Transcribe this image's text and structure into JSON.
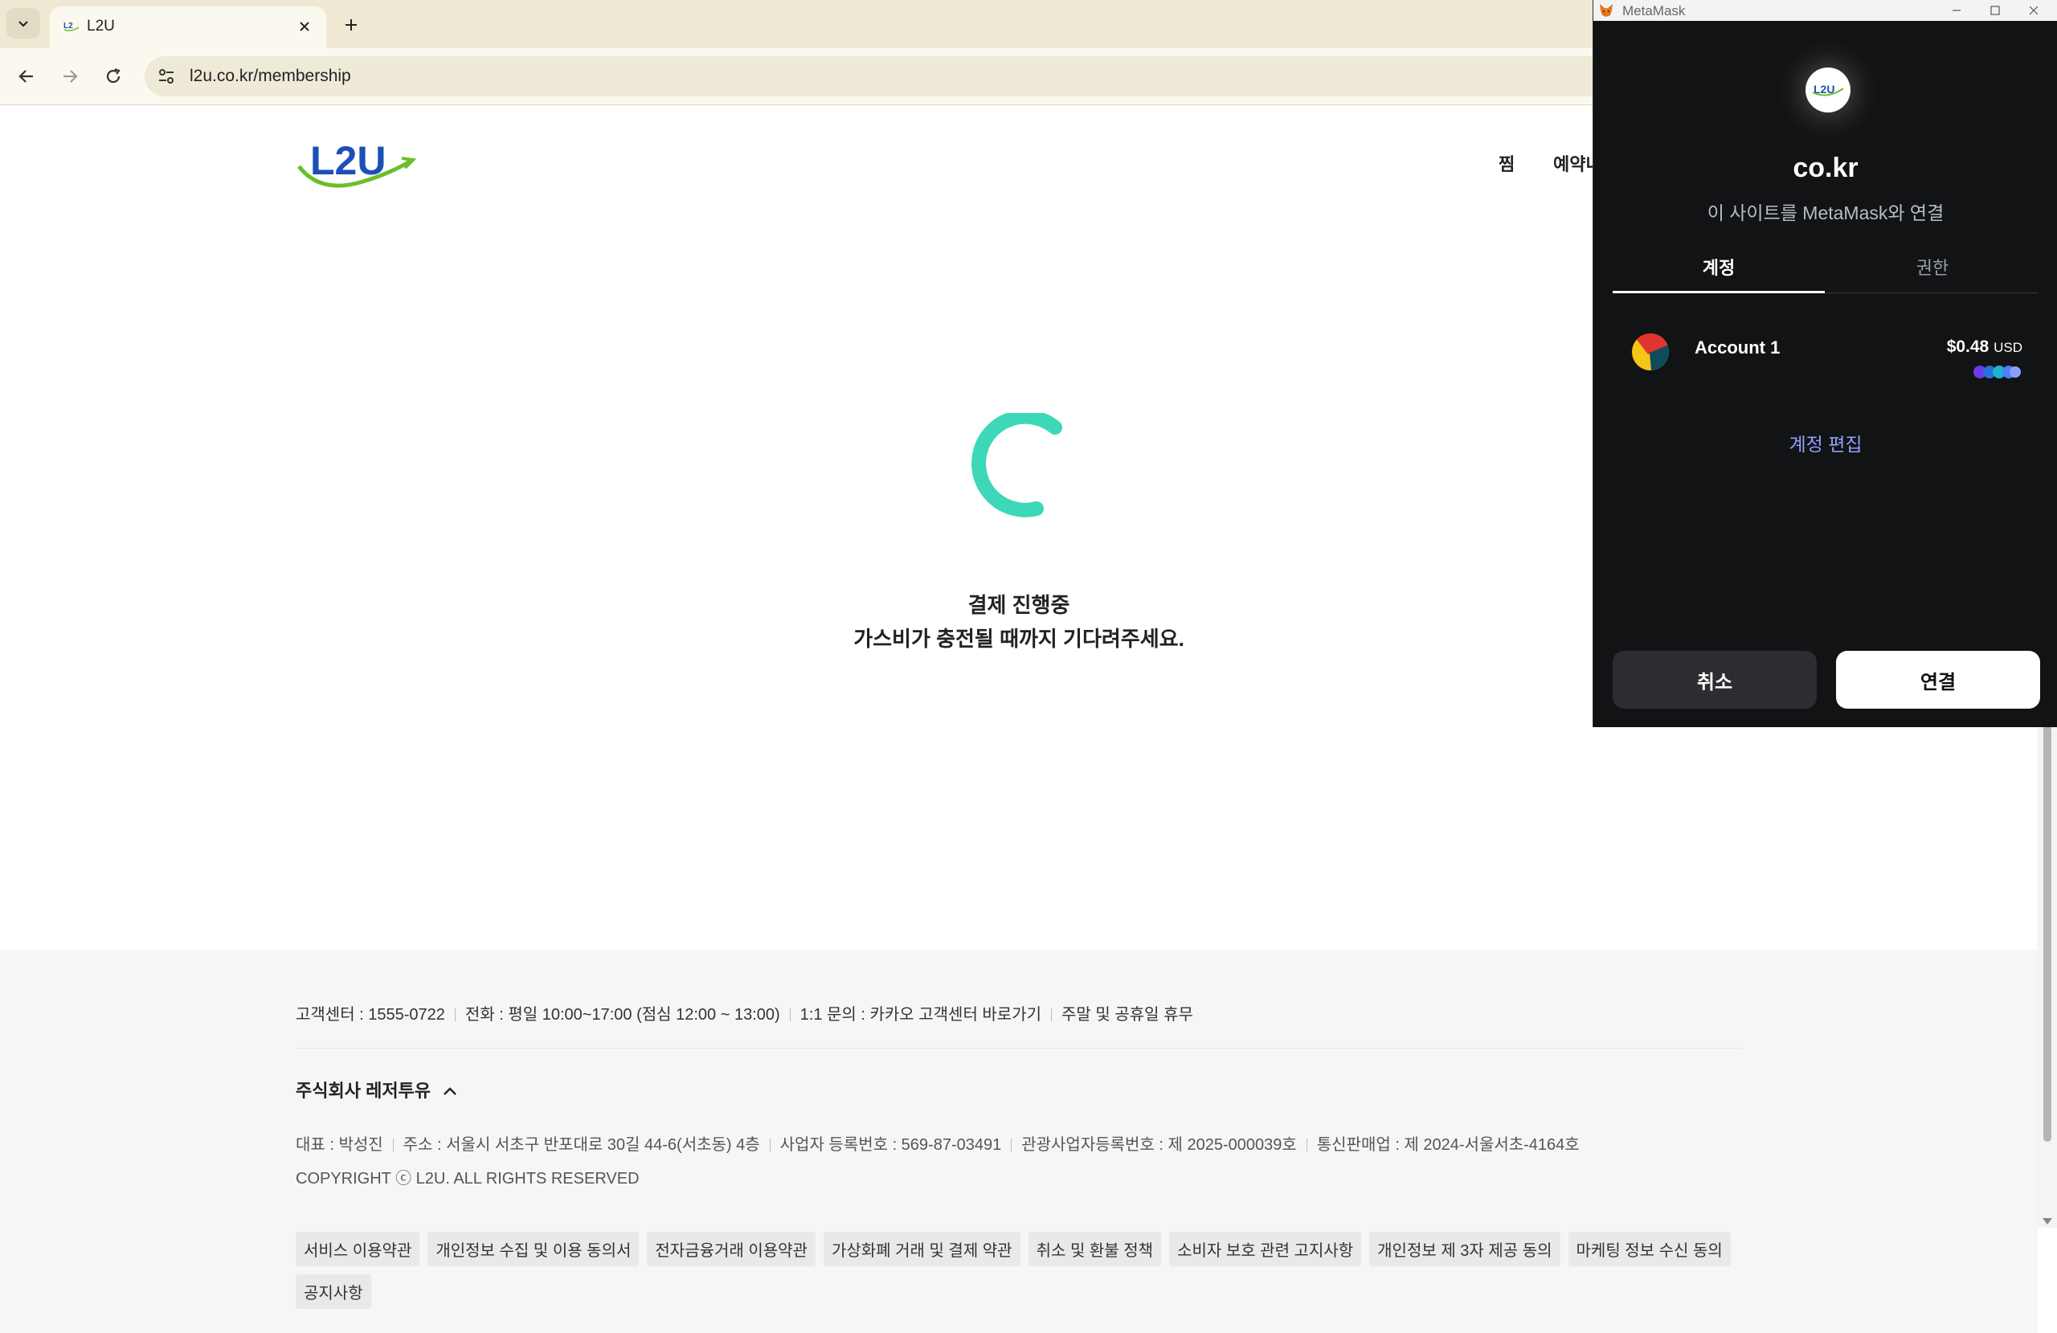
{
  "browser": {
    "tab_title": "L2U",
    "url": "l2u.co.kr/membership"
  },
  "site": {
    "logo_text": "L2U",
    "nav": [
      "찜",
      "예약내"
    ],
    "payment": {
      "title": "결제 진행중",
      "message": "가스비가 충전될 때까지 기다려주세요."
    },
    "footer": {
      "cs_items": [
        "고객센터 : 1555-0722",
        "전화 : 평일 10:00~17:00 (점심 12:00 ~ 13:00)",
        "1:1 문의 : 카카오 고객센터 바로가기",
        "주말 및 공휴일 휴무"
      ],
      "company_name": "주식회사 레저투유",
      "company_info": [
        "대표 : 박성진",
        "주소 : 서울시 서초구 반포대로 30길 44-6(서초동) 4층",
        "사업자 등록번호 : 569-87-03491",
        "관광사업자등록번호 : 제 2025-000039호",
        "통신판매업 : 제 2024-서울서초-4164호"
      ],
      "copyright": "COPYRIGHT ⓒ L2U. ALL RIGHTS RESERVED",
      "links": [
        "서비스 이용약관",
        "개인정보 수집 및 이용 동의서",
        "전자금융거래 이용약관",
        "가상화폐 거래 및 결제 약관",
        "취소 및 환불 정책",
        "소비자 보호 관련 고지사항",
        "개인정보 제 3자 제공 동의",
        "마케팅 정보 수신 동의",
        "공지사항"
      ]
    }
  },
  "metamask": {
    "window_title": "MetaMask",
    "site_avatar_text": "L2U",
    "site_name": "co.kr",
    "subtitle": "이 사이트를 MetaMask와 연결",
    "tabs": [
      "계정",
      "권한"
    ],
    "account": {
      "name": "Account 1",
      "balance": "$0.48",
      "currency": "USD"
    },
    "edit_accounts": "계정 편집",
    "cancel_label": "취소",
    "connect_label": "연결"
  },
  "colors": {
    "spinner": "#3dd8b8",
    "metamask_bg": "#121314",
    "metamask_link": "#8fa0ff",
    "logo_blue": "#1d4fb8",
    "logo_green": "#6cbf2a"
  }
}
